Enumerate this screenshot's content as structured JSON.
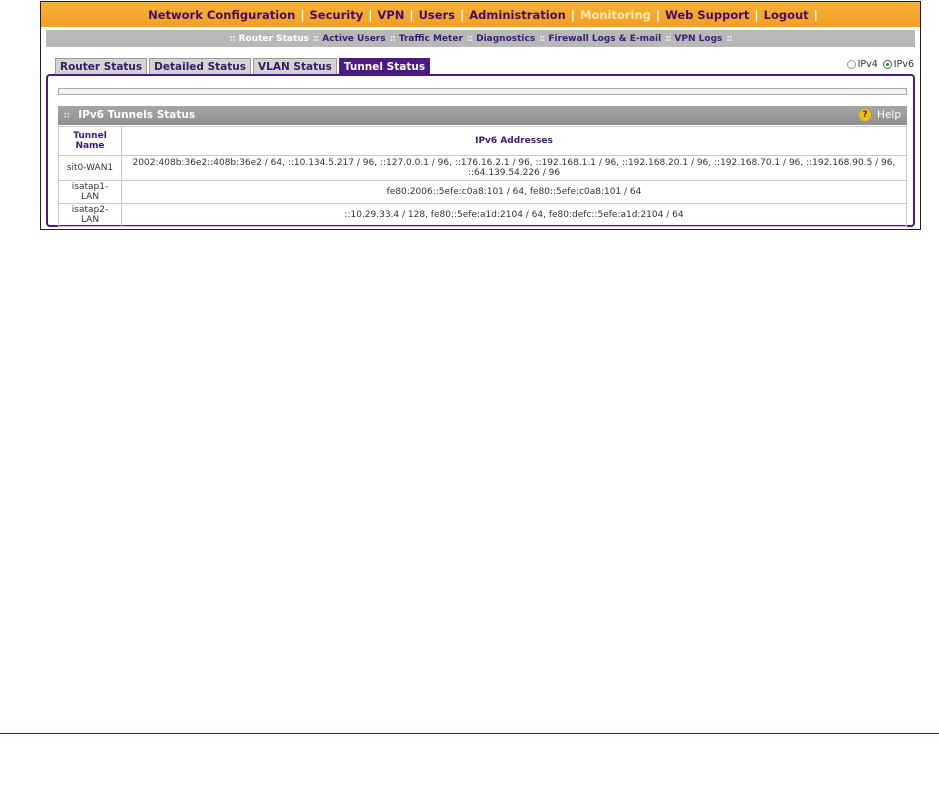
{
  "topnav": {
    "items": [
      {
        "label": "Network Configuration"
      },
      {
        "label": "Security"
      },
      {
        "label": "VPN"
      },
      {
        "label": "Users"
      },
      {
        "label": "Administration"
      },
      {
        "label": "Monitoring"
      },
      {
        "label": "Web Support"
      },
      {
        "label": "Logout"
      }
    ],
    "separator": "|"
  },
  "subnav": {
    "items": [
      {
        "label": "Router Status"
      },
      {
        "label": "Active Users"
      },
      {
        "label": "Traffic Meter"
      },
      {
        "label": "Diagnostics"
      },
      {
        "label": "Firewall Logs & E-mail"
      },
      {
        "label": "VPN Logs"
      }
    ],
    "separator": "::"
  },
  "tabs": [
    {
      "label": "Router Status"
    },
    {
      "label": "Detailed Status"
    },
    {
      "label": "VLAN Status"
    },
    {
      "label": "Tunnel Status"
    }
  ],
  "ip_mode": {
    "ipv4_label": "IPv4",
    "ipv6_label": "IPv6",
    "selected": "IPv6"
  },
  "panel": {
    "title": "IPv6 Tunnels Status",
    "help_label": "Help"
  },
  "table": {
    "headers": {
      "tunnel_name": "Tunnel Name",
      "ipv6_addresses": "IPv6 Addresses"
    },
    "rows": [
      {
        "name": "sit0-WAN1",
        "addresses": "2002:408b:36e2::408b:36e2 / 64, ::10.134.5.217 / 96, ::127.0.0.1 / 96, ::176.16.2.1 / 96, ::192.168.1.1 / 96, ::192.168.20.1 / 96, ::192.168.70.1 / 96, ::192.168.90.5 / 96, ::64.139.54.226 / 96"
      },
      {
        "name": "isatap1-LAN",
        "addresses": "fe80:2006::5efe:c0a8:101 / 64, fe80::5efe:c0a8:101 / 64"
      },
      {
        "name": "isatap2-LAN",
        "addresses": "::10.29.33.4 / 128, fe80::5efe:a1d:2104 / 64, fe80:defc::5efe:a1d:2104 / 64"
      }
    ]
  },
  "colors": {
    "nav_orange": "#f5a623",
    "brand_purple": "#4b1a82",
    "subnav_gray": "#b8b8b8",
    "active_nav_text": "#ffe9b0"
  }
}
